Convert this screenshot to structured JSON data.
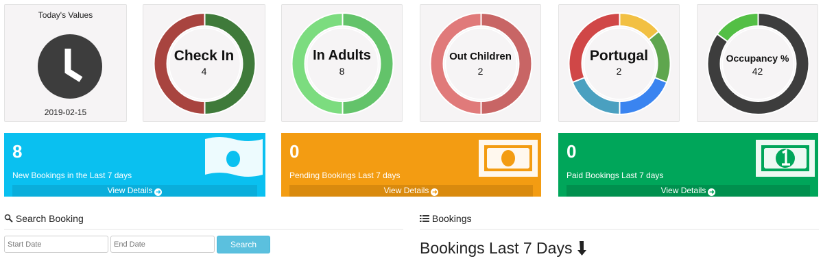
{
  "clock": {
    "title": "Today's Values",
    "date": "2019-02-15",
    "icon": "clock-icon"
  },
  "donuts": [
    {
      "label": "Check In",
      "value": "4",
      "segments": [
        {
          "color": "#3f7a3a",
          "fraction": 0.5
        },
        {
          "color": "#a8443f",
          "fraction": 0.5
        }
      ]
    },
    {
      "label": "In Adults",
      "value": "8",
      "segments": [
        {
          "color": "#63c36a",
          "fraction": 0.5
        },
        {
          "color": "#7cdc7f",
          "fraction": 0.5
        }
      ]
    },
    {
      "label": "Out Children",
      "value": "2",
      "segments": [
        {
          "color": "#c86565",
          "fraction": 0.5
        },
        {
          "color": "#e07a7a",
          "fraction": 0.5
        }
      ]
    },
    {
      "label": "Portugal",
      "value": "2",
      "segments": [
        {
          "color": "#f2c043",
          "fraction": 0.14
        },
        {
          "color": "#5fa64e",
          "fraction": 0.17
        },
        {
          "color": "#3a84f0",
          "fraction": 0.19
        },
        {
          "color": "#4aa0c0",
          "fraction": 0.19
        },
        {
          "color": "#d04747",
          "fraction": 0.31
        }
      ]
    },
    {
      "label": "Occupancy %",
      "value": "42",
      "segments": [
        {
          "color": "#3d3d3d",
          "fraction": 0.85
        },
        {
          "color": "#53bf45",
          "fraction": 0.15
        }
      ]
    }
  ],
  "cards": [
    {
      "count": "8",
      "text": "New Bookings in the Last 7 days",
      "details": "View Details",
      "color": "#0ac0f0",
      "icon": "money-wave-icon"
    },
    {
      "count": "0",
      "text": "Pending Bookings Last 7 days",
      "details": "View Details",
      "color": "#f39c12",
      "icon": "money-bill-icon"
    },
    {
      "count": "0",
      "text": "Paid Bookings Last 7 days",
      "details": "View Details",
      "color": "#00a65a",
      "icon": "money-bill-1-icon"
    }
  ],
  "search": {
    "title": "Search Booking",
    "start_placeholder": "Start Date",
    "end_placeholder": "End Date",
    "button": "Search"
  },
  "bookings": {
    "title": "Bookings",
    "heading": "Bookings Last 7 Days"
  }
}
